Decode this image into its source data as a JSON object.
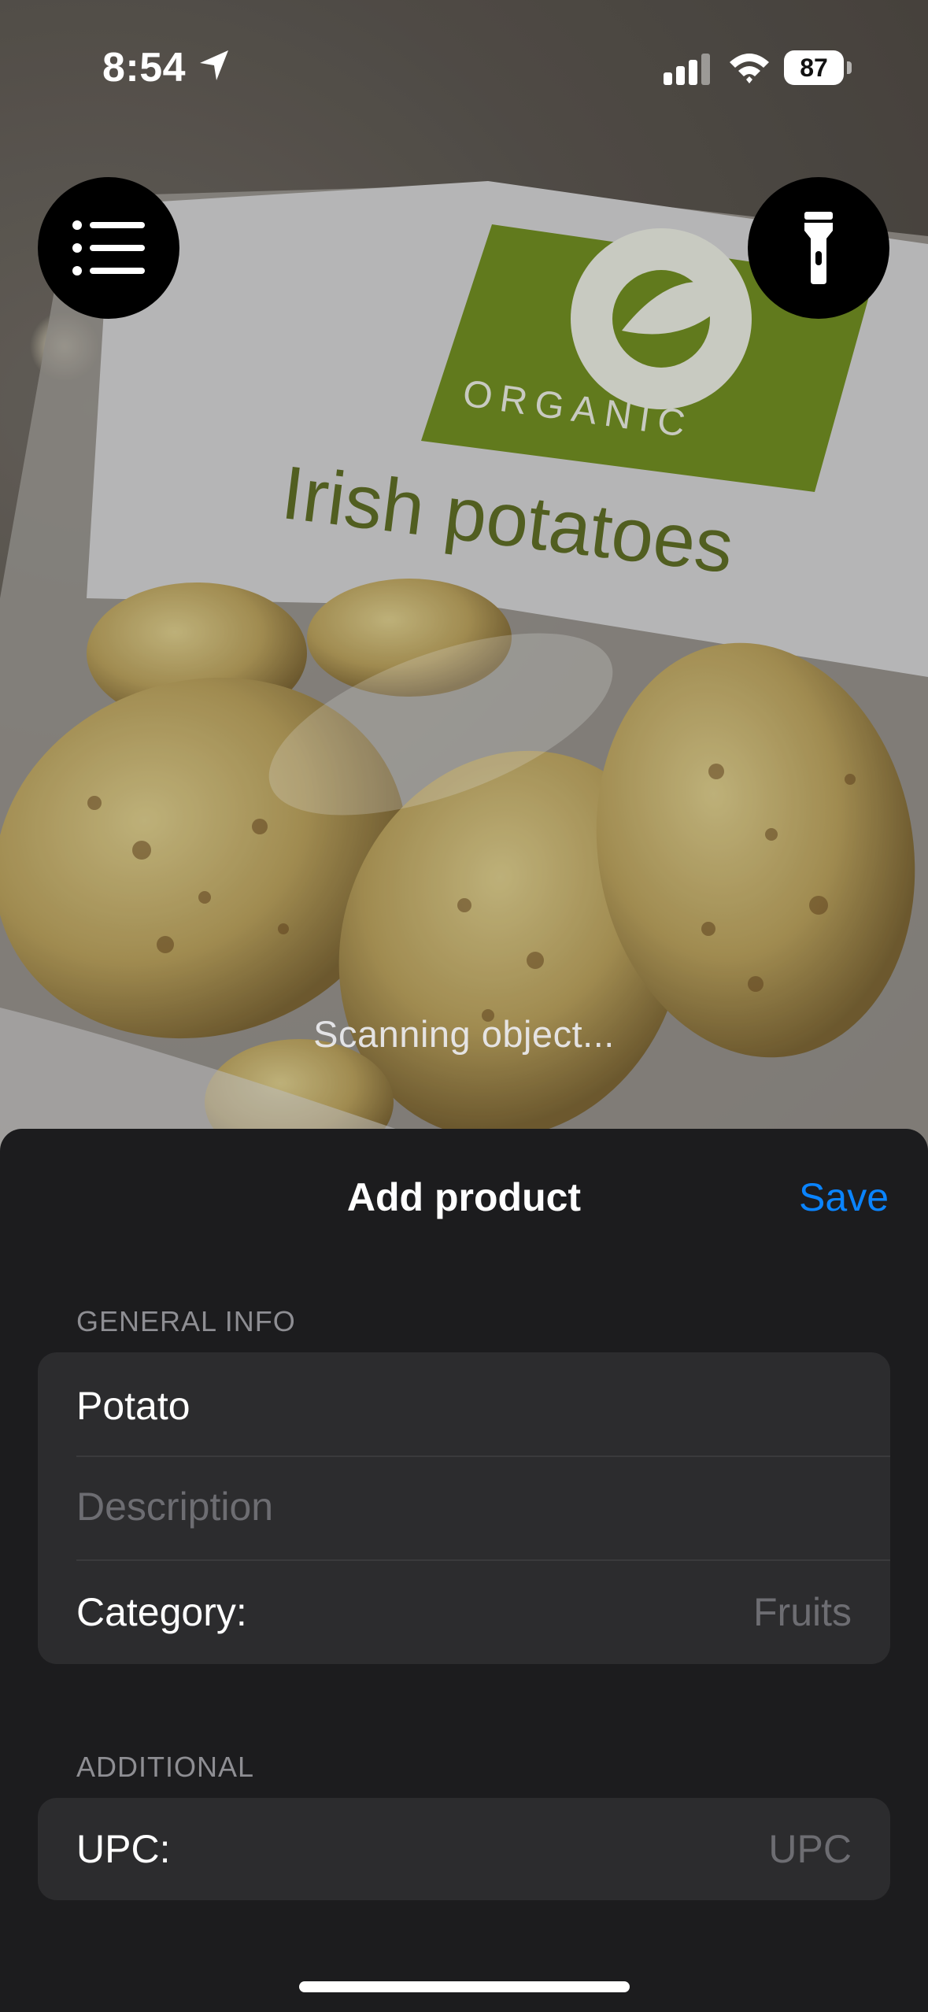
{
  "status_bar": {
    "time": "8:54",
    "battery": "87"
  },
  "camera": {
    "overlay_text": "Scanning object..."
  },
  "sheet": {
    "title": "Add product",
    "save_label": "Save",
    "general_section": {
      "header": "GENERAL INFO",
      "name_value": "Potato",
      "description_placeholder": "Description",
      "category_label": "Category:",
      "category_value": "Fruits"
    },
    "additional_section": {
      "header": "ADDITIONAL",
      "upc_label": "UPC:",
      "upc_placeholder": "UPC"
    }
  },
  "icons": {
    "menu": "list-icon",
    "torch": "flashlight-icon",
    "location": "location-arrow-icon",
    "signal": "cellular-signal-icon",
    "wifi": "wifi-icon",
    "battery": "battery-icon"
  },
  "colors": {
    "accent": "#0a84ff",
    "sheet_bg": "#1c1c1e",
    "group_bg": "#2c2c2e"
  }
}
